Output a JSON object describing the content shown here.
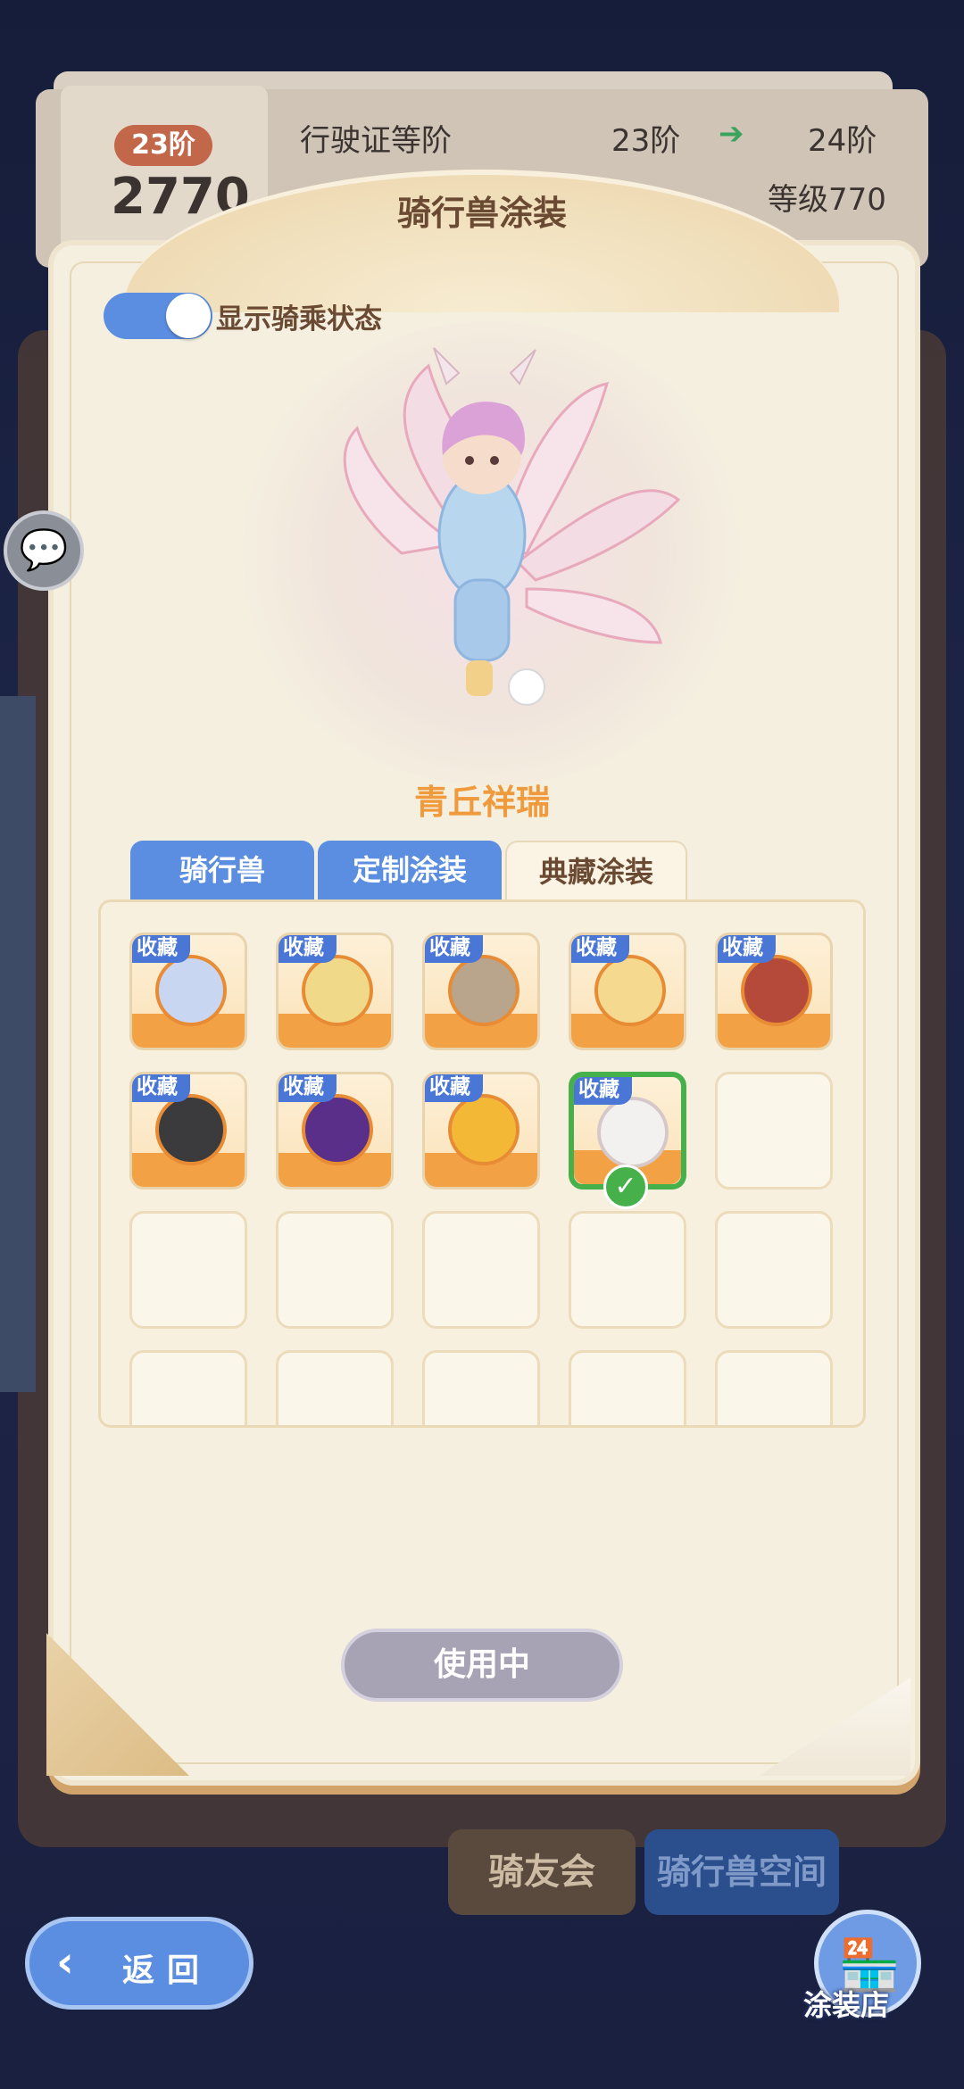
{
  "background": {
    "pass_title": "行驶证等阶",
    "current_tier": "23阶",
    "next_tier": "24阶",
    "tier_badge": "23阶",
    "pass_number": "2770",
    "level_label": "等级770",
    "arrow": "➔"
  },
  "dialog": {
    "title": "骑行兽涂装",
    "toggle_label": "显示骑乘状态",
    "toggle_on": true,
    "mount_name": "青丘祥瑞",
    "tabs": [
      {
        "label": "骑行兽",
        "active": false
      },
      {
        "label": "定制涂装",
        "active": false
      },
      {
        "label": "典藏涂装",
        "active": true
      }
    ],
    "collection_badge": "收藏",
    "slots": [
      {
        "icon": "blue-sword-spirit-icon",
        "collected": true
      },
      {
        "icon": "golden-bow-icon",
        "collected": true
      },
      {
        "icon": "bear-plush-icon",
        "collected": true
      },
      {
        "icon": "golden-girl-icon",
        "collected": true
      },
      {
        "icon": "red-sleigh-icon",
        "collected": true
      },
      {
        "icon": "black-cat-icon",
        "collected": true
      },
      {
        "icon": "purple-mecha-icon",
        "collected": true
      },
      {
        "icon": "golden-sun-wheel-icon",
        "collected": true
      },
      {
        "icon": "white-fox-icon",
        "collected": true,
        "selected": true
      },
      {
        "icon": "",
        "collected": false
      },
      {
        "icon": "",
        "collected": false
      },
      {
        "icon": "",
        "collected": false
      },
      {
        "icon": "",
        "collected": false
      },
      {
        "icon": "",
        "collected": false
      },
      {
        "icon": "",
        "collected": false
      },
      {
        "icon": "",
        "collected": false
      },
      {
        "icon": "",
        "collected": false
      },
      {
        "icon": "",
        "collected": false
      },
      {
        "icon": "",
        "collected": false
      },
      {
        "icon": "",
        "collected": false
      }
    ],
    "use_button": "使用中"
  },
  "bottom_tabs": {
    "friends": "骑友会",
    "space": "骑行兽空间"
  },
  "back_button": "返回",
  "shop_button": "涂装店",
  "colors": {
    "accent_blue": "#5b8ee0",
    "selected_green": "#46b04a",
    "name_orange": "#ef9a3c"
  }
}
